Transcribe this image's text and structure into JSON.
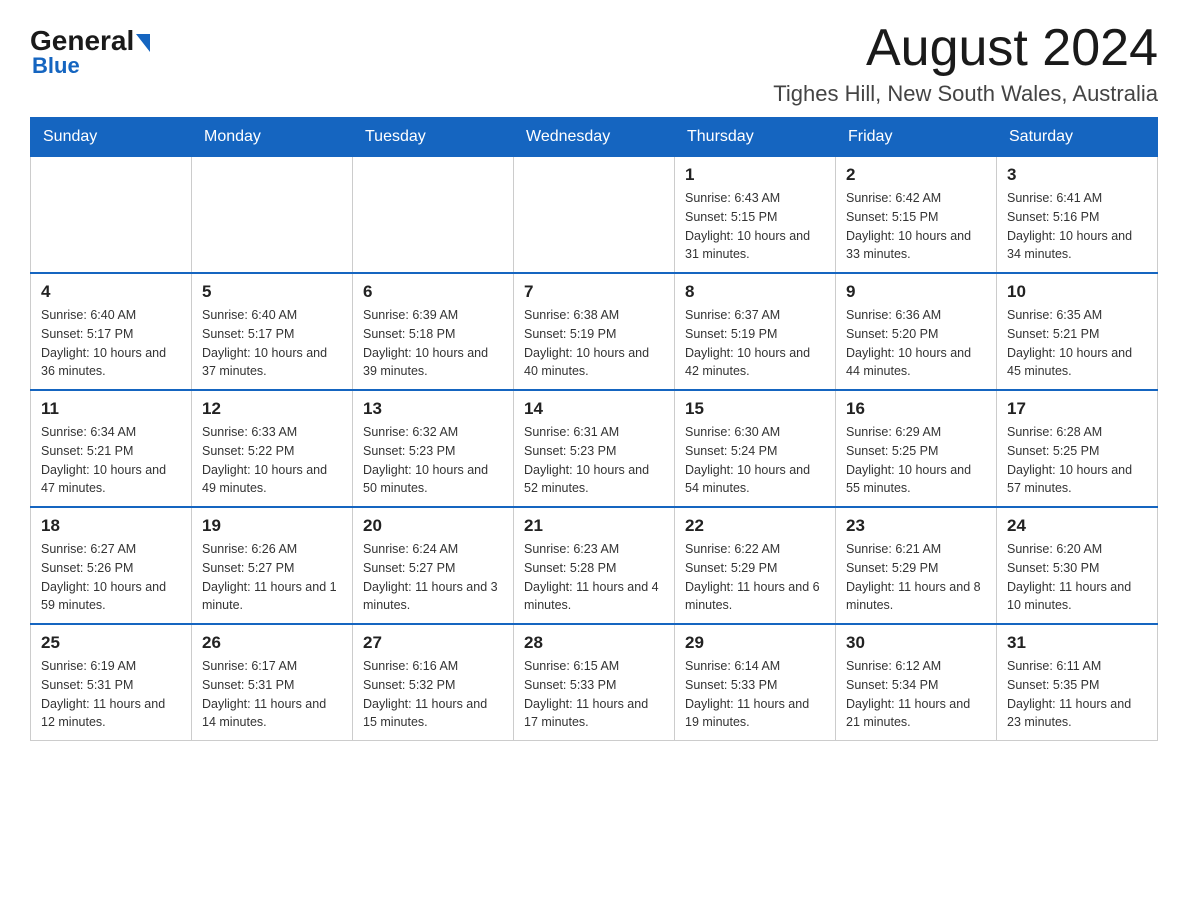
{
  "header": {
    "logo_general": "General",
    "logo_blue": "Blue",
    "month_title": "August 2024",
    "location": "Tighes Hill, New South Wales, Australia"
  },
  "days_of_week": [
    "Sunday",
    "Monday",
    "Tuesday",
    "Wednesday",
    "Thursday",
    "Friday",
    "Saturday"
  ],
  "weeks": [
    [
      {
        "day": "",
        "info": ""
      },
      {
        "day": "",
        "info": ""
      },
      {
        "day": "",
        "info": ""
      },
      {
        "day": "",
        "info": ""
      },
      {
        "day": "1",
        "info": "Sunrise: 6:43 AM\nSunset: 5:15 PM\nDaylight: 10 hours and 31 minutes."
      },
      {
        "day": "2",
        "info": "Sunrise: 6:42 AM\nSunset: 5:15 PM\nDaylight: 10 hours and 33 minutes."
      },
      {
        "day": "3",
        "info": "Sunrise: 6:41 AM\nSunset: 5:16 PM\nDaylight: 10 hours and 34 minutes."
      }
    ],
    [
      {
        "day": "4",
        "info": "Sunrise: 6:40 AM\nSunset: 5:17 PM\nDaylight: 10 hours and 36 minutes."
      },
      {
        "day": "5",
        "info": "Sunrise: 6:40 AM\nSunset: 5:17 PM\nDaylight: 10 hours and 37 minutes."
      },
      {
        "day": "6",
        "info": "Sunrise: 6:39 AM\nSunset: 5:18 PM\nDaylight: 10 hours and 39 minutes."
      },
      {
        "day": "7",
        "info": "Sunrise: 6:38 AM\nSunset: 5:19 PM\nDaylight: 10 hours and 40 minutes."
      },
      {
        "day": "8",
        "info": "Sunrise: 6:37 AM\nSunset: 5:19 PM\nDaylight: 10 hours and 42 minutes."
      },
      {
        "day": "9",
        "info": "Sunrise: 6:36 AM\nSunset: 5:20 PM\nDaylight: 10 hours and 44 minutes."
      },
      {
        "day": "10",
        "info": "Sunrise: 6:35 AM\nSunset: 5:21 PM\nDaylight: 10 hours and 45 minutes."
      }
    ],
    [
      {
        "day": "11",
        "info": "Sunrise: 6:34 AM\nSunset: 5:21 PM\nDaylight: 10 hours and 47 minutes."
      },
      {
        "day": "12",
        "info": "Sunrise: 6:33 AM\nSunset: 5:22 PM\nDaylight: 10 hours and 49 minutes."
      },
      {
        "day": "13",
        "info": "Sunrise: 6:32 AM\nSunset: 5:23 PM\nDaylight: 10 hours and 50 minutes."
      },
      {
        "day": "14",
        "info": "Sunrise: 6:31 AM\nSunset: 5:23 PM\nDaylight: 10 hours and 52 minutes."
      },
      {
        "day": "15",
        "info": "Sunrise: 6:30 AM\nSunset: 5:24 PM\nDaylight: 10 hours and 54 minutes."
      },
      {
        "day": "16",
        "info": "Sunrise: 6:29 AM\nSunset: 5:25 PM\nDaylight: 10 hours and 55 minutes."
      },
      {
        "day": "17",
        "info": "Sunrise: 6:28 AM\nSunset: 5:25 PM\nDaylight: 10 hours and 57 minutes."
      }
    ],
    [
      {
        "day": "18",
        "info": "Sunrise: 6:27 AM\nSunset: 5:26 PM\nDaylight: 10 hours and 59 minutes."
      },
      {
        "day": "19",
        "info": "Sunrise: 6:26 AM\nSunset: 5:27 PM\nDaylight: 11 hours and 1 minute."
      },
      {
        "day": "20",
        "info": "Sunrise: 6:24 AM\nSunset: 5:27 PM\nDaylight: 11 hours and 3 minutes."
      },
      {
        "day": "21",
        "info": "Sunrise: 6:23 AM\nSunset: 5:28 PM\nDaylight: 11 hours and 4 minutes."
      },
      {
        "day": "22",
        "info": "Sunrise: 6:22 AM\nSunset: 5:29 PM\nDaylight: 11 hours and 6 minutes."
      },
      {
        "day": "23",
        "info": "Sunrise: 6:21 AM\nSunset: 5:29 PM\nDaylight: 11 hours and 8 minutes."
      },
      {
        "day": "24",
        "info": "Sunrise: 6:20 AM\nSunset: 5:30 PM\nDaylight: 11 hours and 10 minutes."
      }
    ],
    [
      {
        "day": "25",
        "info": "Sunrise: 6:19 AM\nSunset: 5:31 PM\nDaylight: 11 hours and 12 minutes."
      },
      {
        "day": "26",
        "info": "Sunrise: 6:17 AM\nSunset: 5:31 PM\nDaylight: 11 hours and 14 minutes."
      },
      {
        "day": "27",
        "info": "Sunrise: 6:16 AM\nSunset: 5:32 PM\nDaylight: 11 hours and 15 minutes."
      },
      {
        "day": "28",
        "info": "Sunrise: 6:15 AM\nSunset: 5:33 PM\nDaylight: 11 hours and 17 minutes."
      },
      {
        "day": "29",
        "info": "Sunrise: 6:14 AM\nSunset: 5:33 PM\nDaylight: 11 hours and 19 minutes."
      },
      {
        "day": "30",
        "info": "Sunrise: 6:12 AM\nSunset: 5:34 PM\nDaylight: 11 hours and 21 minutes."
      },
      {
        "day": "31",
        "info": "Sunrise: 6:11 AM\nSunset: 5:35 PM\nDaylight: 11 hours and 23 minutes."
      }
    ]
  ]
}
